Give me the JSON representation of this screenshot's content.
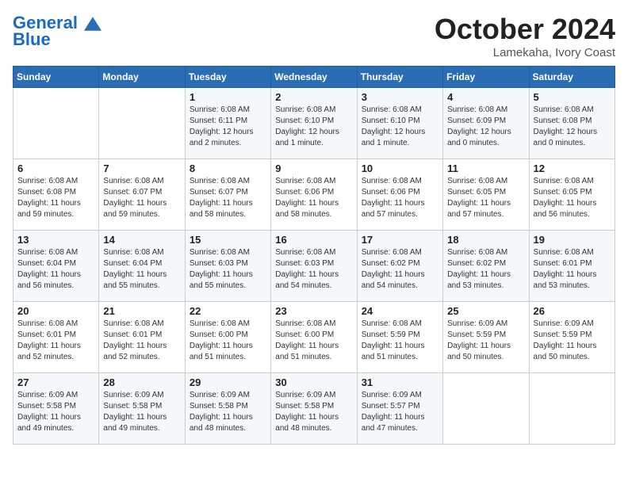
{
  "header": {
    "logo_line1": "General",
    "logo_line2": "Blue",
    "month_title": "October 2024",
    "location": "Lamekaha, Ivory Coast"
  },
  "weekdays": [
    "Sunday",
    "Monday",
    "Tuesday",
    "Wednesday",
    "Thursday",
    "Friday",
    "Saturday"
  ],
  "weeks": [
    [
      {
        "day": "",
        "info": ""
      },
      {
        "day": "",
        "info": ""
      },
      {
        "day": "1",
        "info": "Sunrise: 6:08 AM\nSunset: 6:11 PM\nDaylight: 12 hours\nand 2 minutes."
      },
      {
        "day": "2",
        "info": "Sunrise: 6:08 AM\nSunset: 6:10 PM\nDaylight: 12 hours\nand 1 minute."
      },
      {
        "day": "3",
        "info": "Sunrise: 6:08 AM\nSunset: 6:10 PM\nDaylight: 12 hours\nand 1 minute."
      },
      {
        "day": "4",
        "info": "Sunrise: 6:08 AM\nSunset: 6:09 PM\nDaylight: 12 hours\nand 0 minutes."
      },
      {
        "day": "5",
        "info": "Sunrise: 6:08 AM\nSunset: 6:08 PM\nDaylight: 12 hours\nand 0 minutes."
      }
    ],
    [
      {
        "day": "6",
        "info": "Sunrise: 6:08 AM\nSunset: 6:08 PM\nDaylight: 11 hours\nand 59 minutes."
      },
      {
        "day": "7",
        "info": "Sunrise: 6:08 AM\nSunset: 6:07 PM\nDaylight: 11 hours\nand 59 minutes."
      },
      {
        "day": "8",
        "info": "Sunrise: 6:08 AM\nSunset: 6:07 PM\nDaylight: 11 hours\nand 58 minutes."
      },
      {
        "day": "9",
        "info": "Sunrise: 6:08 AM\nSunset: 6:06 PM\nDaylight: 11 hours\nand 58 minutes."
      },
      {
        "day": "10",
        "info": "Sunrise: 6:08 AM\nSunset: 6:06 PM\nDaylight: 11 hours\nand 57 minutes."
      },
      {
        "day": "11",
        "info": "Sunrise: 6:08 AM\nSunset: 6:05 PM\nDaylight: 11 hours\nand 57 minutes."
      },
      {
        "day": "12",
        "info": "Sunrise: 6:08 AM\nSunset: 6:05 PM\nDaylight: 11 hours\nand 56 minutes."
      }
    ],
    [
      {
        "day": "13",
        "info": "Sunrise: 6:08 AM\nSunset: 6:04 PM\nDaylight: 11 hours\nand 56 minutes."
      },
      {
        "day": "14",
        "info": "Sunrise: 6:08 AM\nSunset: 6:04 PM\nDaylight: 11 hours\nand 55 minutes."
      },
      {
        "day": "15",
        "info": "Sunrise: 6:08 AM\nSunset: 6:03 PM\nDaylight: 11 hours\nand 55 minutes."
      },
      {
        "day": "16",
        "info": "Sunrise: 6:08 AM\nSunset: 6:03 PM\nDaylight: 11 hours\nand 54 minutes."
      },
      {
        "day": "17",
        "info": "Sunrise: 6:08 AM\nSunset: 6:02 PM\nDaylight: 11 hours\nand 54 minutes."
      },
      {
        "day": "18",
        "info": "Sunrise: 6:08 AM\nSunset: 6:02 PM\nDaylight: 11 hours\nand 53 minutes."
      },
      {
        "day": "19",
        "info": "Sunrise: 6:08 AM\nSunset: 6:01 PM\nDaylight: 11 hours\nand 53 minutes."
      }
    ],
    [
      {
        "day": "20",
        "info": "Sunrise: 6:08 AM\nSunset: 6:01 PM\nDaylight: 11 hours\nand 52 minutes."
      },
      {
        "day": "21",
        "info": "Sunrise: 6:08 AM\nSunset: 6:01 PM\nDaylight: 11 hours\nand 52 minutes."
      },
      {
        "day": "22",
        "info": "Sunrise: 6:08 AM\nSunset: 6:00 PM\nDaylight: 11 hours\nand 51 minutes."
      },
      {
        "day": "23",
        "info": "Sunrise: 6:08 AM\nSunset: 6:00 PM\nDaylight: 11 hours\nand 51 minutes."
      },
      {
        "day": "24",
        "info": "Sunrise: 6:08 AM\nSunset: 5:59 PM\nDaylight: 11 hours\nand 51 minutes."
      },
      {
        "day": "25",
        "info": "Sunrise: 6:09 AM\nSunset: 5:59 PM\nDaylight: 11 hours\nand 50 minutes."
      },
      {
        "day": "26",
        "info": "Sunrise: 6:09 AM\nSunset: 5:59 PM\nDaylight: 11 hours\nand 50 minutes."
      }
    ],
    [
      {
        "day": "27",
        "info": "Sunrise: 6:09 AM\nSunset: 5:58 PM\nDaylight: 11 hours\nand 49 minutes."
      },
      {
        "day": "28",
        "info": "Sunrise: 6:09 AM\nSunset: 5:58 PM\nDaylight: 11 hours\nand 49 minutes."
      },
      {
        "day": "29",
        "info": "Sunrise: 6:09 AM\nSunset: 5:58 PM\nDaylight: 11 hours\nand 48 minutes."
      },
      {
        "day": "30",
        "info": "Sunrise: 6:09 AM\nSunset: 5:58 PM\nDaylight: 11 hours\nand 48 minutes."
      },
      {
        "day": "31",
        "info": "Sunrise: 6:09 AM\nSunset: 5:57 PM\nDaylight: 11 hours\nand 47 minutes."
      },
      {
        "day": "",
        "info": ""
      },
      {
        "day": "",
        "info": ""
      }
    ]
  ]
}
